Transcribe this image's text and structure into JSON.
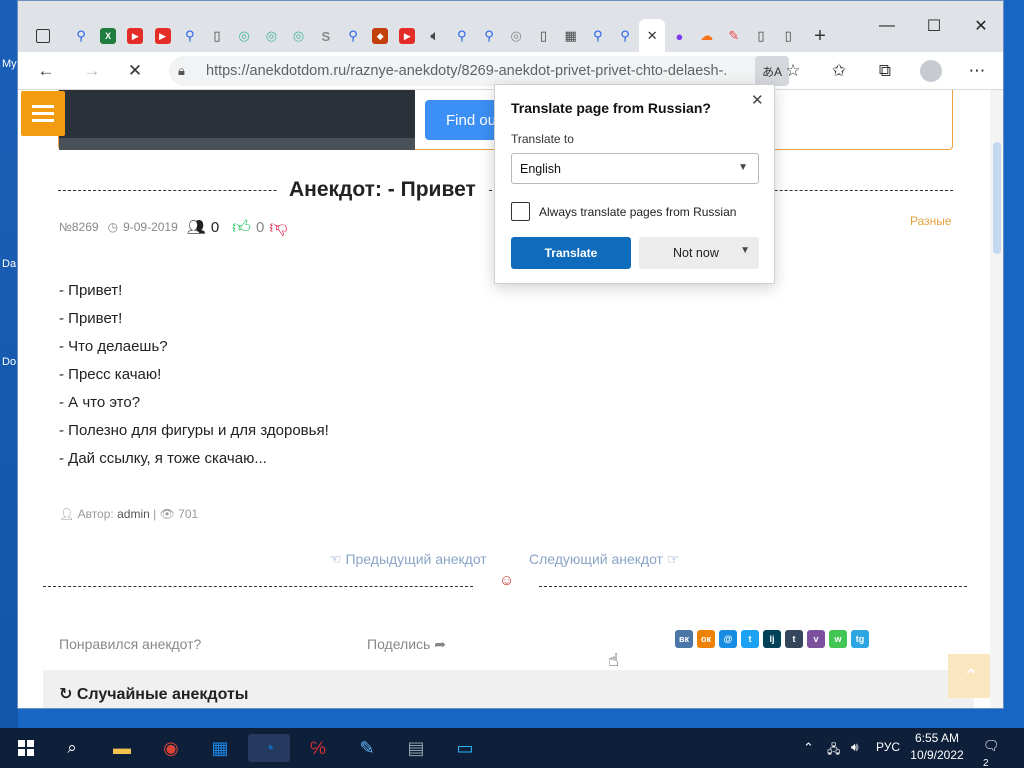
{
  "desktop": {
    "labels": [
      "My",
      "Da",
      "Do"
    ]
  },
  "browser": {
    "tabs": [
      {
        "icon": "tab-icon",
        "color": "#333333"
      },
      {
        "icon": "search-icon",
        "color": "#2563eb"
      },
      {
        "icon": "excel-icon",
        "color": "#1e7e3e"
      },
      {
        "icon": "youtube-icon",
        "color": "#e52d27"
      },
      {
        "icon": "youtube-icon",
        "color": "#e52d27"
      },
      {
        "icon": "search-icon",
        "color": "#2563eb"
      },
      {
        "icon": "document-icon",
        "color": "#444444"
      },
      {
        "icon": "swirl-icon",
        "color": "#48b29c"
      },
      {
        "icon": "swirl-icon",
        "color": "#48b29c"
      },
      {
        "icon": "swirl-icon",
        "color": "#48b29c"
      },
      {
        "icon": "sst-icon",
        "color": "#888888"
      },
      {
        "icon": "search-icon",
        "color": "#2563eb"
      },
      {
        "icon": "shield-icon",
        "color": "#c2410c"
      },
      {
        "icon": "youtube-icon",
        "color": "#e52d27"
      },
      {
        "icon": "speaker-icon",
        "color": "#444444"
      },
      {
        "icon": "search-icon",
        "color": "#2563eb"
      },
      {
        "icon": "search-icon",
        "color": "#2563eb"
      },
      {
        "icon": "swirl-icon",
        "color": "#888888"
      },
      {
        "icon": "document-icon",
        "color": "#444444"
      },
      {
        "icon": "calendar-icon",
        "color": "#444444"
      },
      {
        "icon": "search-icon",
        "color": "#2563eb"
      },
      {
        "icon": "search-icon",
        "color": "#2563eb"
      },
      {
        "icon": "close-icon",
        "color": "#333333"
      },
      {
        "icon": "user-icon",
        "color": "#7c3aed"
      },
      {
        "icon": "cloud-icon",
        "color": "#f97316"
      },
      {
        "icon": "pen-icon",
        "color": "#ef4444"
      },
      {
        "icon": "document-icon",
        "color": "#444444"
      },
      {
        "icon": "document-icon",
        "color": "#444444"
      }
    ],
    "address": {
      "url": "https://anekdotdom.ru/raznye-anekdoty/8269-anekdot-privet-privet-chto-delaesh-...",
      "translate_icon": "あA"
    }
  },
  "page": {
    "ad_button": "Find ou",
    "title": "Анекдот: - Привет",
    "meta": {
      "number": "№8269",
      "date": "9-09-2019",
      "users": "0",
      "likes": "0"
    },
    "category": "Разные",
    "joke_lines": [
      "- Привет!",
      "- Привет!",
      "- Что делаешь?",
      "- Пресс качаю!",
      "- А что это?",
      "- Полезно для фигуры и для здоровья!",
      "- Дай ссылку, я тоже скачаю..."
    ],
    "author_label": "Автор:",
    "author": "admin",
    "views": "701",
    "prev_link": "Предыдущий анекдот",
    "next_link": "Следующий анекдот",
    "liked_label": "Понравился анекдот?",
    "share_label": "Поделись",
    "socials": [
      {
        "name": "vk",
        "label": "вк",
        "color": "#4a76a8"
      },
      {
        "name": "ok",
        "label": "ок",
        "color": "#ee8208"
      },
      {
        "name": "mailru",
        "label": "@",
        "color": "#168de2"
      },
      {
        "name": "twitter",
        "label": "t",
        "color": "#1da1f2"
      },
      {
        "name": "livejournal",
        "label": "lj",
        "color": "#004359"
      },
      {
        "name": "tumblr",
        "label": "t",
        "color": "#35465c"
      },
      {
        "name": "viber",
        "label": "v",
        "color": "#7b519d"
      },
      {
        "name": "whatsapp",
        "label": "w",
        "color": "#43c553"
      },
      {
        "name": "telegram",
        "label": "tg",
        "color": "#2ca5e0"
      }
    ],
    "random_section": "Случайные анекдоты"
  },
  "translate_popup": {
    "title": "Translate page from Russian?",
    "to_label": "Translate to",
    "language": "English",
    "always_label": "Always translate pages from Russian",
    "always_checked": false,
    "translate_button": "Translate",
    "not_now_button": "Not now"
  },
  "taskbar": {
    "apps": [
      {
        "name": "file-explorer",
        "color": "#f2c14e"
      },
      {
        "name": "chrome",
        "color": "#db4437"
      },
      {
        "name": "app-blue",
        "color": "#1e88e5"
      },
      {
        "name": "edge",
        "color": "#0f6cbd"
      },
      {
        "name": "app-red",
        "color": "#d32f2f"
      },
      {
        "name": "app-pen",
        "color": "#64b5f6"
      },
      {
        "name": "app-screens",
        "color": "#90a4ae"
      },
      {
        "name": "app-window",
        "color": "#29b6f6"
      }
    ],
    "language": "РУС",
    "time": "6:55 AM",
    "date": "10/9/2022",
    "notifications": "2"
  }
}
